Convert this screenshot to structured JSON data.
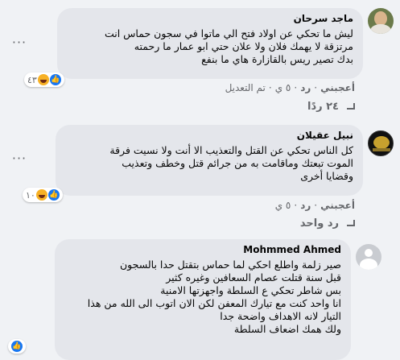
{
  "comments": [
    {
      "author": "ماجد سرحان",
      "lines": [
        "ليش ما تحكي عن اولاد فتح الي ماتوا في سجون حماس انت",
        "مرتزقة لا يهمك فلان ولا علان حتي ابو عمار ما رحمته",
        "بدك تصير ريس بالقازارة هاي ما بنفع"
      ],
      "reactions_count": "٤٣",
      "actions": {
        "like": "أعجبني",
        "reply": "رد",
        "time": "٥ ي",
        "edited": "تم التعديل"
      },
      "replies_label": "٢٤ ردًا"
    },
    {
      "author": "نبيل عقيلان",
      "lines": [
        "كل الناس تحكي عن القتل والتعذيب الا أنت ولا نسيت فرقة",
        "الموت تبعتك وماقامت به من جرائم قتل وخطف وتعذيب",
        "وقضايا أخرى"
      ],
      "reactions_count": "١٠",
      "actions": {
        "like": "أعجبني",
        "reply": "رد",
        "time": "٥ ي"
      },
      "replies_label": "رد واحد"
    },
    {
      "author": "Mohmmed Ahmed",
      "lines": [
        "صير زلمة واطلع احكي لما حماس بتقتل حدا بالسجون",
        "قبل سنة قتلت عصام السعافين وغيره كثير",
        "بس شاطر تحكي ع السلطة واجهزتها الامنية",
        "انا واحد كنت مع تيارك المعفن لكن الان اتوب الى الله من هذا",
        "التيار لانه الاهداف واضحة جدا",
        "ولك همك اضعاف السلطة"
      ]
    }
  ]
}
